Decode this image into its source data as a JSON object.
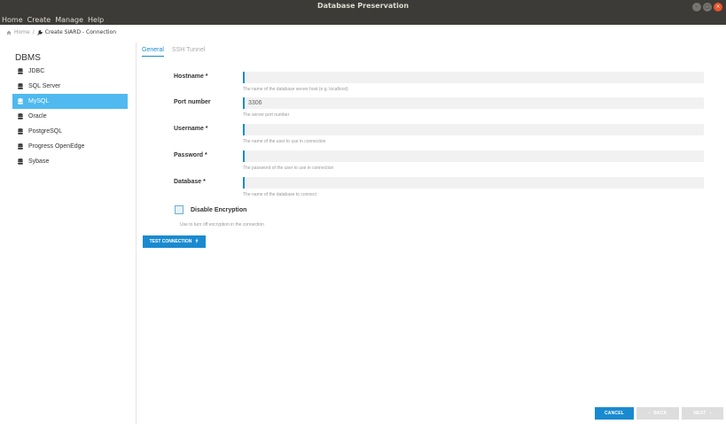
{
  "window": {
    "title": "Database Preservation"
  },
  "menu": [
    "Home",
    "Create",
    "Manage",
    "Help"
  ],
  "breadcrumb": {
    "home": "Home",
    "separator": "/",
    "current": "Create SIARD - Connection"
  },
  "sidebar": {
    "title": "DBMS",
    "items": [
      {
        "label": "JDBC",
        "icon": "database-icon"
      },
      {
        "label": "SQL Server",
        "icon": "database-icon"
      },
      {
        "label": "MySQL",
        "icon": "database-icon",
        "selected": true
      },
      {
        "label": "Oracle",
        "icon": "database-icon"
      },
      {
        "label": "PostgreSQL",
        "icon": "database-icon"
      },
      {
        "label": "Progress OpenEdge",
        "icon": "database-icon"
      },
      {
        "label": "Sybase",
        "icon": "database-icon"
      }
    ]
  },
  "tabs": [
    {
      "label": "General",
      "active": true
    },
    {
      "label": "SSH Tunnel",
      "active": false
    }
  ],
  "form": {
    "hostname": {
      "label": "Hostname *",
      "value": "",
      "help": "The name of the database server host (e.g. localhost)"
    },
    "port": {
      "label": "Port number",
      "value": "3306",
      "help": "The server port number"
    },
    "username": {
      "label": "Username *",
      "value": "",
      "help": "The name of the user to use in connection"
    },
    "password": {
      "label": "Password *",
      "value": "",
      "help": "The password of the user to use in connection"
    },
    "database": {
      "label": "Database *",
      "value": "",
      "help": "The name of the database to connect"
    },
    "encryption": {
      "label": "Disable Encryption",
      "checked": false,
      "help": "Use to turn off encryption in the connection"
    }
  },
  "buttons": {
    "test_connection": "TEST CONNECTION",
    "cancel": "CANCEL",
    "back": "BACK",
    "next": "NEXT"
  },
  "colors": {
    "accent": "#1a8ad0",
    "selected": "#4fb9f0",
    "titlebar": "#3c3b37"
  }
}
